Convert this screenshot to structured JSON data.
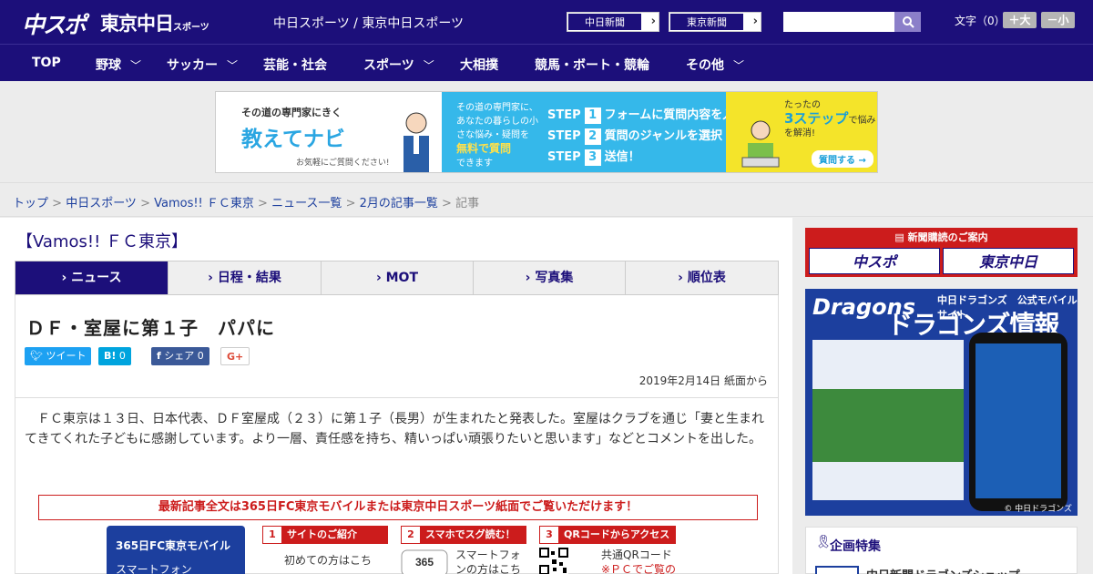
{
  "header": {
    "logo_main": "中スポ",
    "logo_tokyo": "東京中日",
    "logo_tokyo_small": "スポーツ",
    "site_names": "中日スポーツ / 東京中日スポーツ",
    "btn_chunichi": "中日新聞",
    "btn_tokyo": "東京新聞",
    "search_placeholder": "",
    "fontsize_label": "文字（0）",
    "font_large": "＋大",
    "font_small": "－小"
  },
  "nav": {
    "items": [
      "TOP",
      "野球",
      "サッカー",
      "芸能・社会",
      "スポーツ",
      "大相撲",
      "競馬・ボート・競輪",
      "その他"
    ]
  },
  "banner": {
    "tagline": "その道の専門家にきく",
    "title": "教えてナビ",
    "sub": "お気軽にご質問ください!",
    "mid_text": "その道の専門家に、あなたの暮らしの小さな悩み・疑問を",
    "mid_em": "無料で質問",
    "mid_end": "できます",
    "steps": [
      "フォームに質問内容を入力",
      "質問のジャンルを選択",
      "送信！"
    ],
    "right_text": "たったの",
    "right_em": "3ステップ",
    "right_end": "で悩みを解消!",
    "right_btn": "質問する →"
  },
  "breadcrumb": {
    "items": [
      "トップ",
      "中日スポーツ",
      "Vamos!!  ＦＣ東京",
      "ニュース一覧",
      "2月の記事一覧"
    ],
    "current": "記事"
  },
  "main": {
    "section_title": "【Vamos!!  ＦＣ東京】",
    "tabs": [
      "ニュース",
      "日程・結果",
      "MOT",
      "写真集",
      "順位表"
    ],
    "headline": "ＤＦ・室屋に第１子　パパに",
    "share": {
      "tweet": "ツイート",
      "hatena": "0",
      "facebook": "シェア 0",
      "gplus": "G+"
    },
    "date": "2019年2月14日 紙面から",
    "body": "ＦＣ東京は１３日、日本代表、ＤＦ室屋成（２３）に第１子（長男）が生まれたと発表した。室屋はクラブを通じ「妻と生まれてきてくれた子どもに感謝しています。より一層、責任感を持ち、精いっぱい頑張りたいと思います」などとコメントを出した。",
    "promo_head": "最新記事全文は365日FC東京モバイルまたは東京中日スポーツ紙面でご覧いただけます！",
    "promo_card_title": "365日FC東京モバイル",
    "promo_card_sub": "スマートフォン",
    "promo_steps": [
      "サイトのご紹介",
      "スマホでスグ読む！",
      "QRコードからアクセス"
    ],
    "promo_text1": "初めての方はこち",
    "promo_text2a": "スマートフォ",
    "promo_text2b": "ンの方はこち",
    "promo_text3a": "共通QRコード",
    "promo_text3b": "※ＰＣでご覧の"
  },
  "sidebar": {
    "subscribe_title": "新聞購読のご案内",
    "sub_box1": "中スポ",
    "sub_box2": "東京中日",
    "dragons_logo": "Dragons",
    "dragons_label": "中日ドラゴンズ　公式モバイルサイト",
    "dragons_title": "ドラゴンズ情報",
    "dragons_copy": "© 中日ドラゴンズ",
    "kikaku_title": "企画特集",
    "kikaku_item": "中日新聞ドラゴンズショップ"
  }
}
